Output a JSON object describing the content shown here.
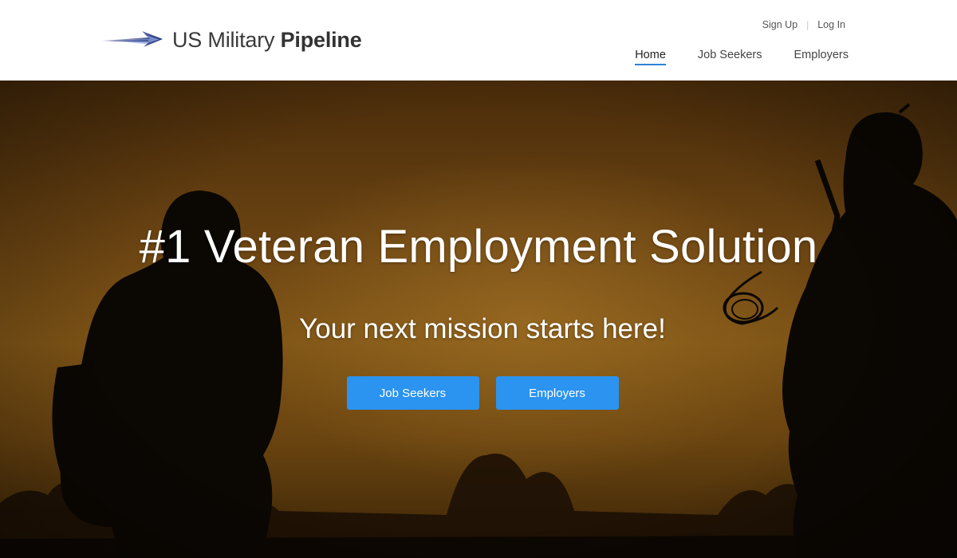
{
  "header": {
    "brand": {
      "light": "US Military ",
      "bold": "Pipeline"
    },
    "auth": {
      "sign_up": "Sign Up",
      "separator": "|",
      "log_in": "Log In"
    },
    "nav": [
      {
        "label": "Home",
        "active": true
      },
      {
        "label": "Job Seekers",
        "active": false
      },
      {
        "label": "Employers",
        "active": false
      }
    ]
  },
  "hero": {
    "title": "#1 Veteran Employment Solution",
    "subtitle": "Your next mission starts here!",
    "buttons": {
      "job_seekers": "Job Seekers",
      "employers": "Employers"
    }
  },
  "colors": {
    "accent": "#2b93f0",
    "nav_underline": "#2f7fd6",
    "hero_tone": "#7e5416"
  },
  "icons": {
    "logo": "arrow-logo-icon"
  }
}
